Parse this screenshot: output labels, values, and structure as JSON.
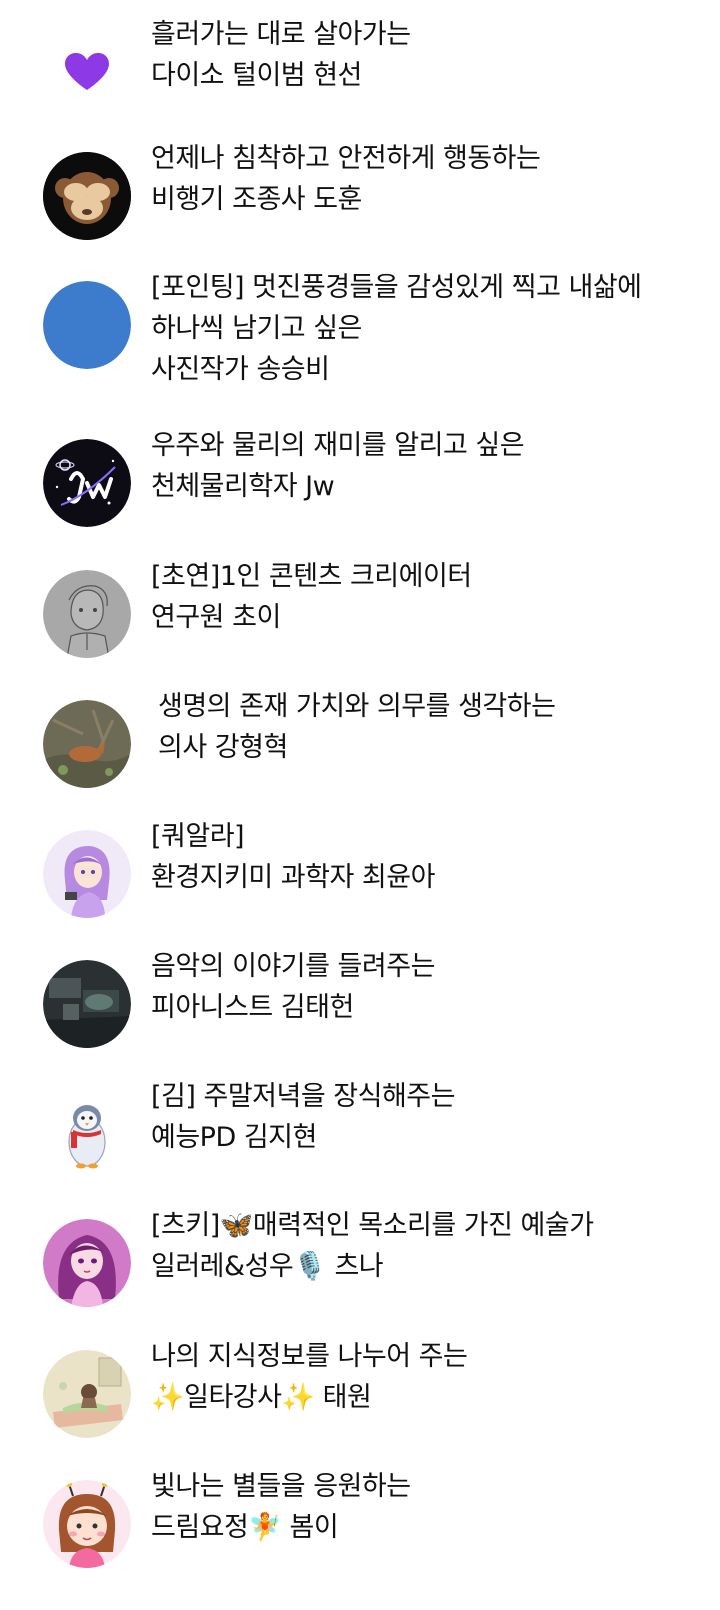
{
  "profiles": [
    {
      "avatar": "purple-heart-icon",
      "lines": [
        "흘러가는 대로 살아가는",
        "다이소 털이범 현선"
      ]
    },
    {
      "avatar": "see-no-evil-monkey-icon",
      "lines": [
        "언제나 침착하고 안전하게 행동하는",
        "비행기 조종사 도훈"
      ]
    },
    {
      "avatar": "blue-circle-avatar",
      "lines": [
        "[포인팅] 멋진풍경들을 감성있게 찍고 내삶에",
        "하나씩 남기고 싶은",
        "사진작가 송승비"
      ]
    },
    {
      "avatar": "jw-logo-avatar",
      "lines": [
        "우주와 물리의 재미를 알리고 싶은",
        "천체물리학자 Jw"
      ]
    },
    {
      "avatar": "sketch-portrait-avatar",
      "lines": [
        "[초연]1인 콘텐츠 크리에이터",
        "연구원 초이"
      ]
    },
    {
      "avatar": "fox-photo-avatar",
      "lines": [
        "생명의 존재 가치와 의무를 생각하는",
        "의사 강형혁"
      ]
    },
    {
      "avatar": "purple-hair-girl-avatar",
      "lines": [
        "[쿼알라]",
        "환경지키미 과학자 최윤아"
      ]
    },
    {
      "avatar": "dark-photo-avatar",
      "lines": [
        "음악의 이야기를 들려주는",
        "피아니스트 김태헌"
      ]
    },
    {
      "avatar": "penguin-avatar",
      "lines": [
        "[김] 주말저녁을 장식해주는",
        "예능PD 김지현"
      ]
    },
    {
      "avatar": "pink-hair-girl-avatar",
      "lines": [
        "[츠키]🦋매력적인 목소리를 가진 예술가",
        "일러레&성우🎙️ 츠나"
      ]
    },
    {
      "avatar": "sleeping-character-avatar",
      "lines": [
        "나의 지식정보를 나누어 주는",
        "✨일타강사✨ 태원"
      ]
    },
    {
      "avatar": "bee-girl-avatar",
      "lines": [
        "빛나는 별들을 응원하는",
        "드림요정🧚 봄이"
      ]
    }
  ]
}
